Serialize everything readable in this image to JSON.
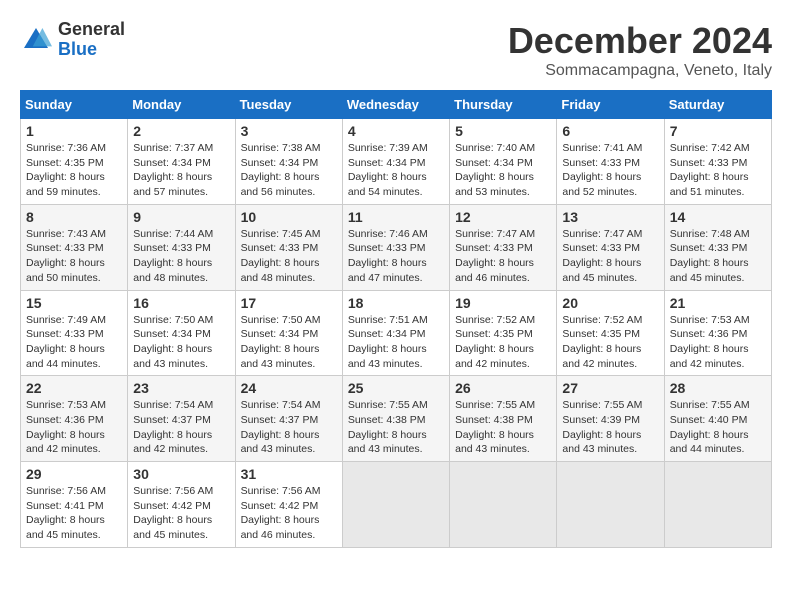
{
  "logo": {
    "general": "General",
    "blue": "Blue"
  },
  "title": "December 2024",
  "location": "Sommacampagna, Veneto, Italy",
  "weekdays": [
    "Sunday",
    "Monday",
    "Tuesday",
    "Wednesday",
    "Thursday",
    "Friday",
    "Saturday"
  ],
  "weeks": [
    [
      {
        "day": "1",
        "sunrise": "7:36 AM",
        "sunset": "4:35 PM",
        "daylight": "8 hours and 59 minutes."
      },
      {
        "day": "2",
        "sunrise": "7:37 AM",
        "sunset": "4:34 PM",
        "daylight": "8 hours and 57 minutes."
      },
      {
        "day": "3",
        "sunrise": "7:38 AM",
        "sunset": "4:34 PM",
        "daylight": "8 hours and 56 minutes."
      },
      {
        "day": "4",
        "sunrise": "7:39 AM",
        "sunset": "4:34 PM",
        "daylight": "8 hours and 54 minutes."
      },
      {
        "day": "5",
        "sunrise": "7:40 AM",
        "sunset": "4:34 PM",
        "daylight": "8 hours and 53 minutes."
      },
      {
        "day": "6",
        "sunrise": "7:41 AM",
        "sunset": "4:33 PM",
        "daylight": "8 hours and 52 minutes."
      },
      {
        "day": "7",
        "sunrise": "7:42 AM",
        "sunset": "4:33 PM",
        "daylight": "8 hours and 51 minutes."
      }
    ],
    [
      {
        "day": "8",
        "sunrise": "7:43 AM",
        "sunset": "4:33 PM",
        "daylight": "8 hours and 50 minutes."
      },
      {
        "day": "9",
        "sunrise": "7:44 AM",
        "sunset": "4:33 PM",
        "daylight": "8 hours and 48 minutes."
      },
      {
        "day": "10",
        "sunrise": "7:45 AM",
        "sunset": "4:33 PM",
        "daylight": "8 hours and 48 minutes."
      },
      {
        "day": "11",
        "sunrise": "7:46 AM",
        "sunset": "4:33 PM",
        "daylight": "8 hours and 47 minutes."
      },
      {
        "day": "12",
        "sunrise": "7:47 AM",
        "sunset": "4:33 PM",
        "daylight": "8 hours and 46 minutes."
      },
      {
        "day": "13",
        "sunrise": "7:47 AM",
        "sunset": "4:33 PM",
        "daylight": "8 hours and 45 minutes."
      },
      {
        "day": "14",
        "sunrise": "7:48 AM",
        "sunset": "4:33 PM",
        "daylight": "8 hours and 45 minutes."
      }
    ],
    [
      {
        "day": "15",
        "sunrise": "7:49 AM",
        "sunset": "4:33 PM",
        "daylight": "8 hours and 44 minutes."
      },
      {
        "day": "16",
        "sunrise": "7:50 AM",
        "sunset": "4:34 PM",
        "daylight": "8 hours and 43 minutes."
      },
      {
        "day": "17",
        "sunrise": "7:50 AM",
        "sunset": "4:34 PM",
        "daylight": "8 hours and 43 minutes."
      },
      {
        "day": "18",
        "sunrise": "7:51 AM",
        "sunset": "4:34 PM",
        "daylight": "8 hours and 43 minutes."
      },
      {
        "day": "19",
        "sunrise": "7:52 AM",
        "sunset": "4:35 PM",
        "daylight": "8 hours and 42 minutes."
      },
      {
        "day": "20",
        "sunrise": "7:52 AM",
        "sunset": "4:35 PM",
        "daylight": "8 hours and 42 minutes."
      },
      {
        "day": "21",
        "sunrise": "7:53 AM",
        "sunset": "4:36 PM",
        "daylight": "8 hours and 42 minutes."
      }
    ],
    [
      {
        "day": "22",
        "sunrise": "7:53 AM",
        "sunset": "4:36 PM",
        "daylight": "8 hours and 42 minutes."
      },
      {
        "day": "23",
        "sunrise": "7:54 AM",
        "sunset": "4:37 PM",
        "daylight": "8 hours and 42 minutes."
      },
      {
        "day": "24",
        "sunrise": "7:54 AM",
        "sunset": "4:37 PM",
        "daylight": "8 hours and 43 minutes."
      },
      {
        "day": "25",
        "sunrise": "7:55 AM",
        "sunset": "4:38 PM",
        "daylight": "8 hours and 43 minutes."
      },
      {
        "day": "26",
        "sunrise": "7:55 AM",
        "sunset": "4:38 PM",
        "daylight": "8 hours and 43 minutes."
      },
      {
        "day": "27",
        "sunrise": "7:55 AM",
        "sunset": "4:39 PM",
        "daylight": "8 hours and 43 minutes."
      },
      {
        "day": "28",
        "sunrise": "7:55 AM",
        "sunset": "4:40 PM",
        "daylight": "8 hours and 44 minutes."
      }
    ],
    [
      {
        "day": "29",
        "sunrise": "7:56 AM",
        "sunset": "4:41 PM",
        "daylight": "8 hours and 45 minutes."
      },
      {
        "day": "30",
        "sunrise": "7:56 AM",
        "sunset": "4:42 PM",
        "daylight": "8 hours and 45 minutes."
      },
      {
        "day": "31",
        "sunrise": "7:56 AM",
        "sunset": "4:42 PM",
        "daylight": "8 hours and 46 minutes."
      },
      null,
      null,
      null,
      null
    ]
  ]
}
